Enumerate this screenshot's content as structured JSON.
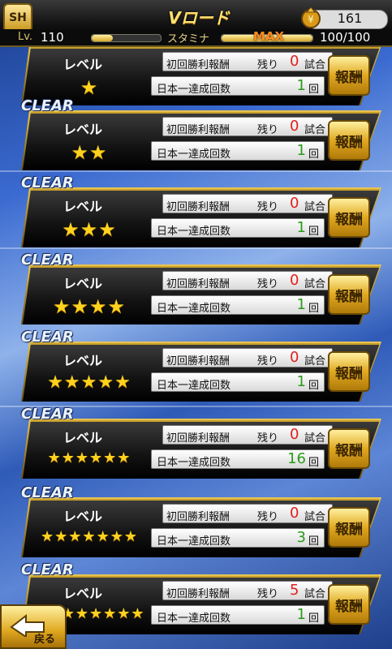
{
  "header": {
    "logo": "SH",
    "title": "Vロード",
    "coins": "161",
    "level_label": "Lv.",
    "level": "110",
    "stamina_label": "スタミナ",
    "stamina_max": "MAX",
    "stamina_value": "100/100",
    "exp_fraction": 0.3
  },
  "labels": {
    "clear": "CLEAR",
    "level": "レベル",
    "first_win_reward": "初回勝利報酬",
    "remaining": "残り",
    "matches_unit": "試合",
    "championships": "日本一達成回数",
    "times_unit": "回",
    "reward_button": "報酬",
    "back_button": "戻る"
  },
  "rows": [
    {
      "stars": 1,
      "cleared": true,
      "remaining": "0",
      "count": "1"
    },
    {
      "stars": 2,
      "cleared": true,
      "remaining": "0",
      "count": "1"
    },
    {
      "stars": 3,
      "cleared": true,
      "remaining": "0",
      "count": "1"
    },
    {
      "stars": 4,
      "cleared": true,
      "remaining": "0",
      "count": "1"
    },
    {
      "stars": 5,
      "cleared": true,
      "remaining": "0",
      "count": "1"
    },
    {
      "stars": 6,
      "cleared": true,
      "remaining": "0",
      "count": "16"
    },
    {
      "stars": 7,
      "cleared": true,
      "remaining": "0",
      "count": "3"
    },
    {
      "stars": 8,
      "cleared": true,
      "remaining": "5",
      "count": "1"
    }
  ],
  "colors": {
    "accent_gold": "#e0a820",
    "remaining_red": "#e0201e",
    "count_green": "#2a9a1a"
  }
}
